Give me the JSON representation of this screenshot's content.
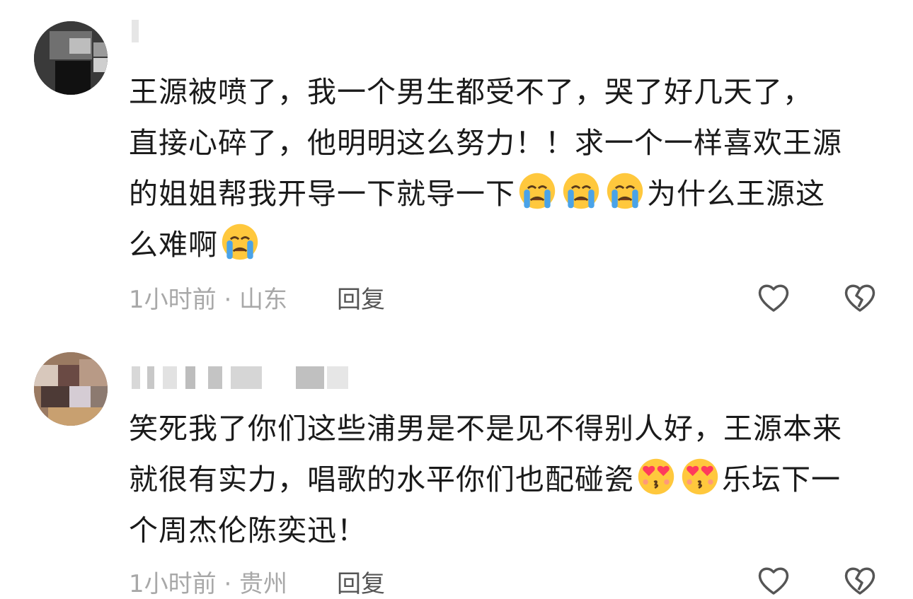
{
  "comments": [
    {
      "text_lines": [
        "王源被喷了，我一个男生都受不了，哭了好几天了，",
        "直接心碎了，他明明这么努力！！求一个一样喜欢王源",
        "的姐姐帮我开导一下就导一下",
        "为什么王源这",
        "么难啊"
      ],
      "emoji": "crying-face",
      "meta": "1小时前 · 山东",
      "reply_label": "回复"
    },
    {
      "text_lines": [
        "笑死我了你们这些浦男是不是见不得别人好，王源本来",
        "就很有实力，唱歌的水平你们也配碰瓷",
        "乐坛下一",
        "个周杰伦陈奕迅！"
      ],
      "emoji": "heart-eyes-face",
      "meta": "1小时前 · 贵州",
      "reply_label": "回复"
    }
  ],
  "icons": {
    "like": "heart-outline-icon",
    "dislike": "broken-heart-icon"
  },
  "colors": {
    "text": "#1a1a1a",
    "meta": "#a8a8a8",
    "icon": "#555555",
    "tear": "#4aa3e8",
    "face": "#ffc83d",
    "heart": "#ff3b5c"
  }
}
